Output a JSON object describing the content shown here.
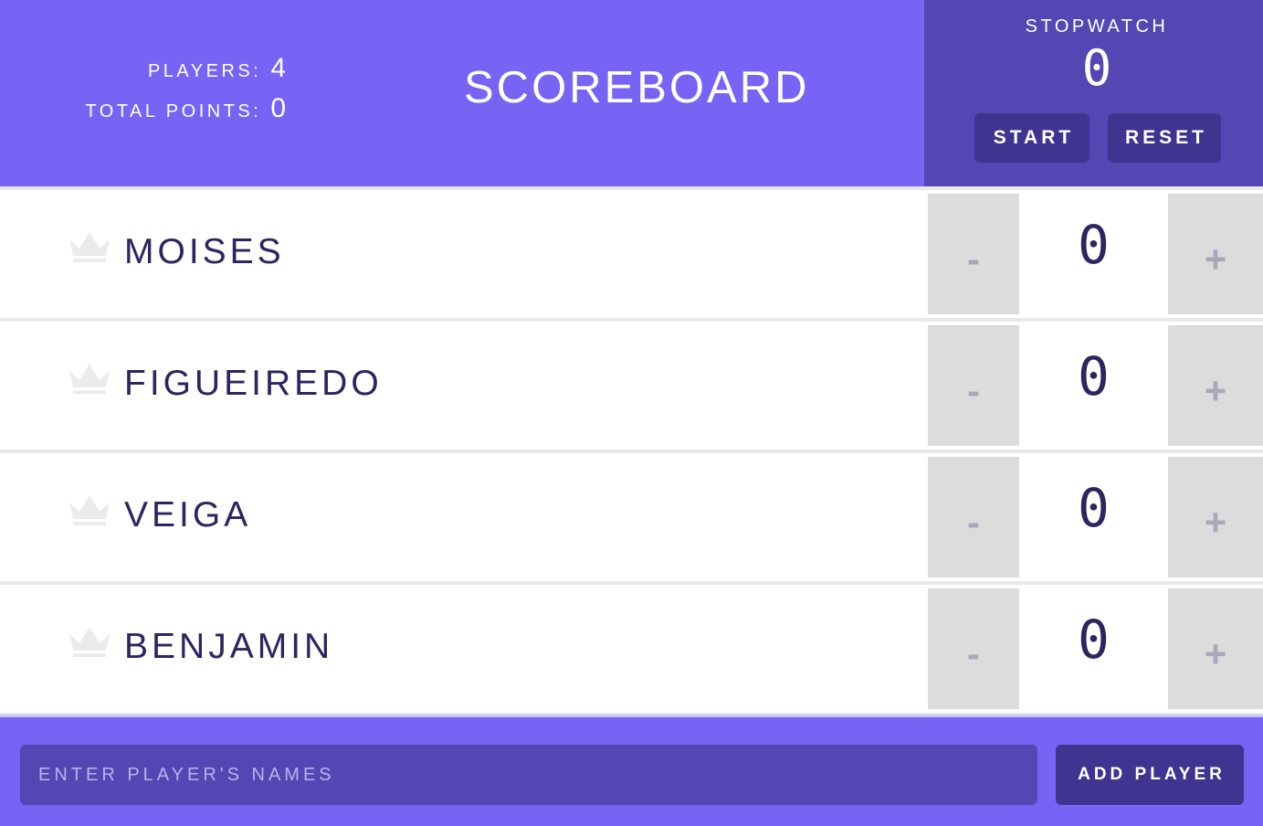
{
  "header": {
    "players_label": "PLAYERS:",
    "players_count": "4",
    "points_label": "TOTAL POINTS:",
    "points_total": "0",
    "title": "SCOREBOARD"
  },
  "stopwatch": {
    "label": "STOPWATCH",
    "time": "0",
    "start_label": "START",
    "reset_label": "RESET"
  },
  "players": [
    {
      "name": "MOISES",
      "score": "0",
      "decrement": "-",
      "increment": "+",
      "icon": "crown-icon"
    },
    {
      "name": "FIGUEIREDO",
      "score": "0",
      "decrement": "-",
      "increment": "+",
      "icon": "crown-icon"
    },
    {
      "name": "VEIGA",
      "score": "0",
      "decrement": "-",
      "increment": "+",
      "icon": "crown-icon"
    },
    {
      "name": "BENJAMIN",
      "score": "0",
      "decrement": "-",
      "increment": "+",
      "icon": "crown-icon"
    }
  ],
  "footer": {
    "input_placeholder": "ENTER PLAYER'S NAMES",
    "input_value": "",
    "add_label": "ADD PLAYER"
  },
  "colors": {
    "header_bg": "#7764f4",
    "stopwatch_bg": "#5447b4",
    "button_bg": "#3f3590",
    "text_dark": "#2c2560",
    "counter_bg": "#dcdcdc",
    "crown": "#ebebeb"
  }
}
